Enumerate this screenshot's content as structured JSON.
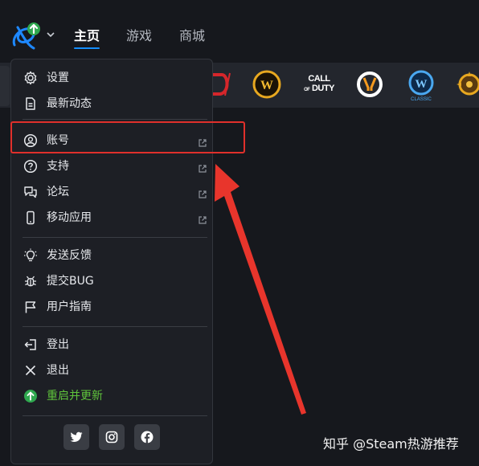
{
  "nav": {
    "tabs": [
      {
        "label": "主页",
        "active": true
      },
      {
        "label": "游戏",
        "active": false
      },
      {
        "label": "商城",
        "active": false
      }
    ]
  },
  "games": [
    {
      "name": "diablo-icon"
    },
    {
      "name": "warcraft-icon"
    },
    {
      "name": "call-of-duty-icon",
      "text_top": "CALL",
      "text_mid": "OF",
      "text_bottom": "DUTY"
    },
    {
      "name": "overwatch-icon"
    },
    {
      "name": "wow-classic-icon",
      "sub": "CLASSIC"
    },
    {
      "name": "hearthstone-icon"
    }
  ],
  "menu": {
    "settings": "设置",
    "news": "最新动态",
    "account": "账号",
    "support": "支持",
    "forums": "论坛",
    "mobile": "移动应用",
    "feedback": "发送反馈",
    "bug": "提交BUG",
    "guide": "用户指南",
    "logout": "登出",
    "exit": "退出",
    "restart_update": "重启并更新"
  },
  "social": [
    "twitter-icon",
    "instagram-icon",
    "facebook-icon"
  ],
  "watermark": "知乎 @Steam热游推荐",
  "colors": {
    "accent": "#148eff",
    "highlight": "#e0302b",
    "update_green": "#5fc33c",
    "menu_bg": "#1d1f25"
  }
}
